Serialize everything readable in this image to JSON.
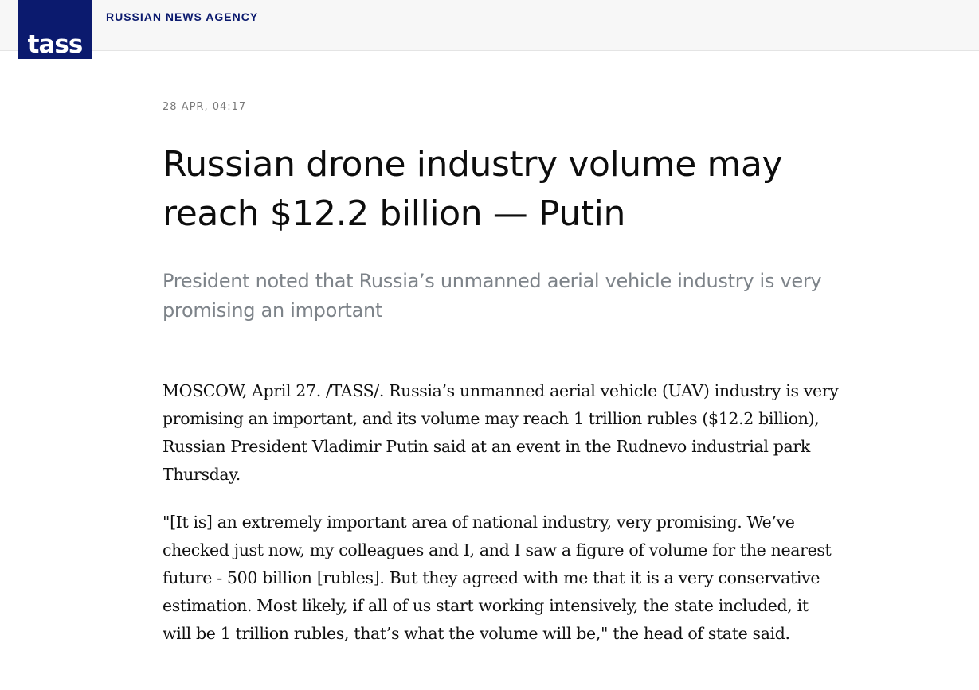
{
  "header": {
    "logo_text": "TASS",
    "tagline": "RUSSIAN NEWS AGENCY",
    "colors": {
      "brand": "#0b1a6e",
      "background": "#f7f7f7"
    }
  },
  "article": {
    "dateline": "28 APR, 04:17",
    "headline": "Russian drone industry volume may reach $12.2 billion — Putin",
    "lead": "President noted that Russia’s unmanned aerial vehicle industry is very promising an important",
    "paragraphs": [
      "MOSCOW, April 27. /TASS/. Russia’s unmanned aerial vehicle (UAV) industry is very promising an important, and its volume may reach 1 trillion rubles ($12.2 billion), Russian President Vladimir Putin said at an event in the Rudnevo industrial park Thursday.",
      "\"[It is] an extremely important area of national industry, very promising. We’ve checked just now, my colleagues and I, and I saw a figure of volume for the nearest future - 500 billion [rubles]. But they agreed with me that it is a very conservative estimation. Most likely, if all of us start working intensively, the state included, it will be 1 trillion rubles, that’s what the volume will be,\" the head of state said."
    ]
  }
}
